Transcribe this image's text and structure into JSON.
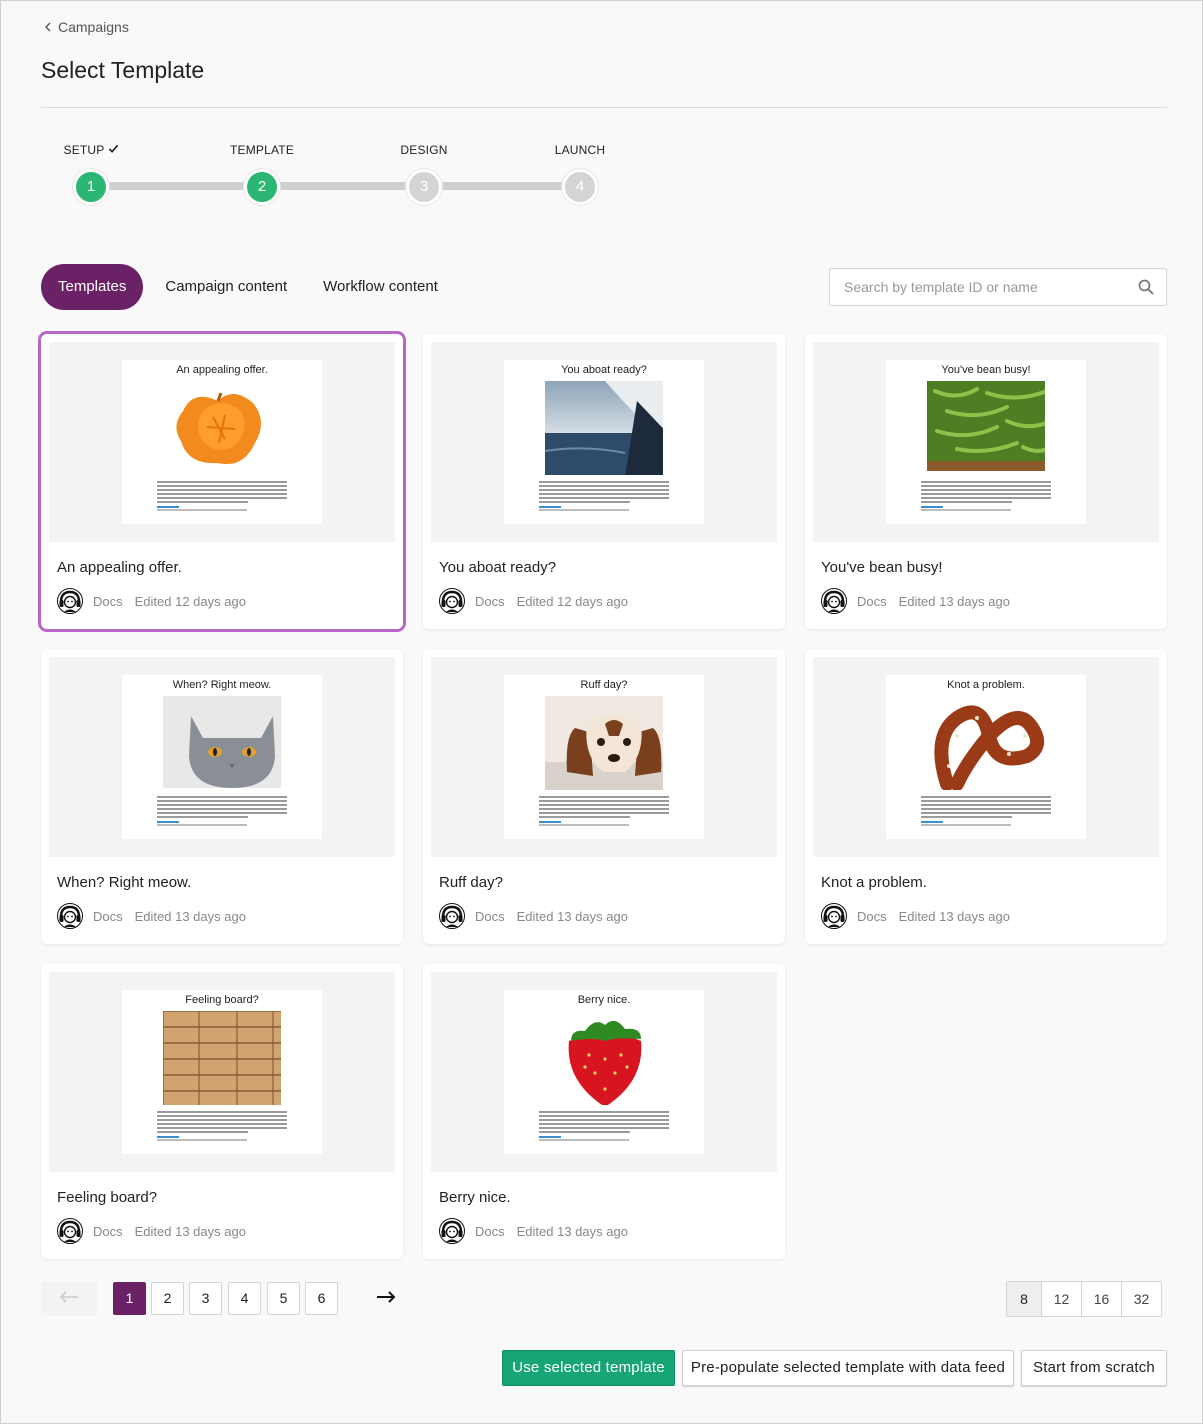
{
  "breadcrumb": {
    "back_label": "Campaigns"
  },
  "page": {
    "title": "Select Template"
  },
  "stepper": {
    "steps": [
      {
        "label": "SETUP",
        "number": "1",
        "state": "done",
        "checked": true
      },
      {
        "label": "TEMPLATE",
        "number": "2",
        "state": "current",
        "checked": false
      },
      {
        "label": "DESIGN",
        "number": "3",
        "state": "todo",
        "checked": false
      },
      {
        "label": "LAUNCH",
        "number": "4",
        "state": "todo",
        "checked": false
      }
    ]
  },
  "tabs": [
    {
      "label": "Templates",
      "active": true
    },
    {
      "label": "Campaign content",
      "active": false
    },
    {
      "label": "Workflow content",
      "active": false
    }
  ],
  "search": {
    "placeholder": "Search by template ID or name",
    "value": ""
  },
  "cards": [
    {
      "title": "An appealing offer.",
      "preview_heading": "An appealing offer.",
      "image": "orange",
      "owner": "Docs",
      "edited": "Edited 12 days ago",
      "selected": true
    },
    {
      "title": "You aboat ready?",
      "preview_heading": "You aboat ready?",
      "image": "sailboat",
      "owner": "Docs",
      "edited": "Edited 12 days ago",
      "selected": false
    },
    {
      "title": "You've bean busy!",
      "preview_heading": "You've bean busy!",
      "image": "green-beans",
      "owner": "Docs",
      "edited": "Edited 13 days ago",
      "selected": false
    },
    {
      "title": "When? Right meow.",
      "preview_heading": "When? Right meow.",
      "image": "cat",
      "owner": "Docs",
      "edited": "Edited 13 days ago",
      "selected": false
    },
    {
      "title": "Ruff day?",
      "preview_heading": "Ruff day?",
      "image": "dog",
      "owner": "Docs",
      "edited": "Edited 13 days ago",
      "selected": false
    },
    {
      "title": "Knot a problem.",
      "preview_heading": "Knot a problem.",
      "image": "pretzel",
      "owner": "Docs",
      "edited": "Edited 13 days ago",
      "selected": false
    },
    {
      "title": "Feeling board?",
      "preview_heading": "Feeling board?",
      "image": "wood-boards",
      "owner": "Docs",
      "edited": "Edited 13 days ago",
      "selected": false
    },
    {
      "title": "Berry nice.",
      "preview_heading": "Berry nice.",
      "image": "strawberry",
      "owner": "Docs",
      "edited": "Edited 13 days ago",
      "selected": false
    }
  ],
  "pagination": {
    "pages": [
      "1",
      "2",
      "3",
      "4",
      "5",
      "6"
    ],
    "current": "1",
    "prev_icon": "arrow-left-icon",
    "next_icon": "arrow-right-icon"
  },
  "page_size": {
    "options": [
      "8",
      "12",
      "16",
      "32"
    ],
    "selected": "8"
  },
  "actions": {
    "use_selected": "Use selected template",
    "prepopulate": "Pre-populate selected template with data feed",
    "start_scratch": "Start from scratch"
  },
  "colors": {
    "brand_purple": "#6b2166",
    "selected_outline": "#b767c4",
    "success_green": "#2bb673",
    "primary_button": "#17a673",
    "step_todo": "#d4d4d4"
  }
}
